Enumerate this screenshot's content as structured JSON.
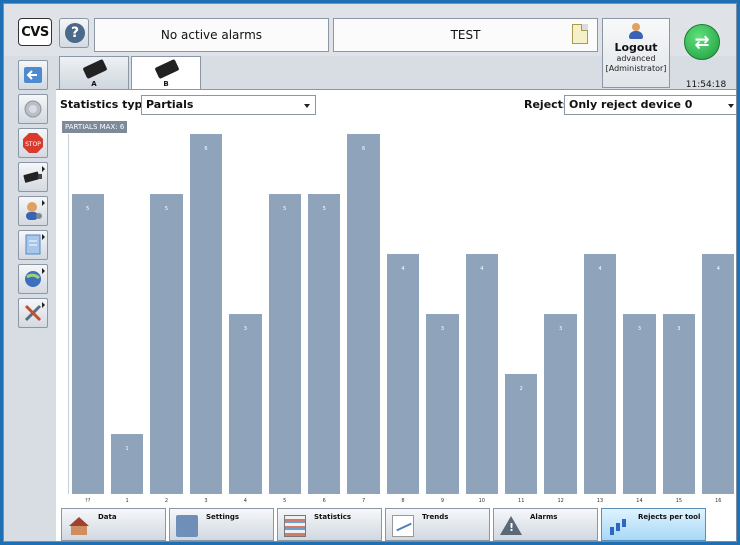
{
  "header": {
    "logo_text": "CVS",
    "help_glyph": "?",
    "alarm_status": "No active alarms",
    "job_name": "TEST",
    "logout_label": "Logout",
    "user_level": "advanced",
    "user_role": "[Administrator]",
    "time": "11:54:18"
  },
  "tabs": [
    {
      "label": "A",
      "active": false
    },
    {
      "label": "B",
      "active": true
    }
  ],
  "controls": {
    "statistics_type_label": "Statistics type",
    "statistics_type_value": "Partials",
    "rejects_label": "Rejects",
    "rejects_value": "Only reject device 0"
  },
  "chart_data": {
    "type": "bar",
    "title": "PARTIALS MAX: 6",
    "categories": [
      "??",
      "1",
      "2",
      "3",
      "4",
      "5",
      "6",
      "7",
      "8",
      "9",
      "10",
      "11",
      "12",
      "13",
      "14",
      "15",
      "16"
    ],
    "values": [
      5,
      1,
      5,
      6,
      3,
      5,
      5,
      6,
      4,
      3,
      4,
      2,
      3,
      4,
      3,
      3,
      4
    ],
    "ylim": [
      0,
      6
    ],
    "bar_color": "#8fa3ba"
  },
  "sidebar": [
    {
      "icon": "back-arrow-icon"
    },
    {
      "icon": "disabled-icon"
    },
    {
      "icon": "stop-icon"
    },
    {
      "icon": "camera-icon"
    },
    {
      "icon": "user-settings-icon"
    },
    {
      "icon": "document-icon"
    },
    {
      "icon": "network-icon"
    },
    {
      "icon": "tools-icon"
    }
  ],
  "bottom_nav": [
    {
      "label": "Data",
      "icon": "home-icon",
      "active": false
    },
    {
      "label": "Settings",
      "icon": "settings-icon",
      "active": false
    },
    {
      "label": "Statistics",
      "icon": "statistics-icon",
      "active": false
    },
    {
      "label": "Trends",
      "icon": "trends-icon",
      "active": false
    },
    {
      "label": "Alarms",
      "icon": "alarm-icon",
      "active": false
    },
    {
      "label": "Rejects per tool",
      "icon": "rejects-chart-icon",
      "active": true
    }
  ]
}
